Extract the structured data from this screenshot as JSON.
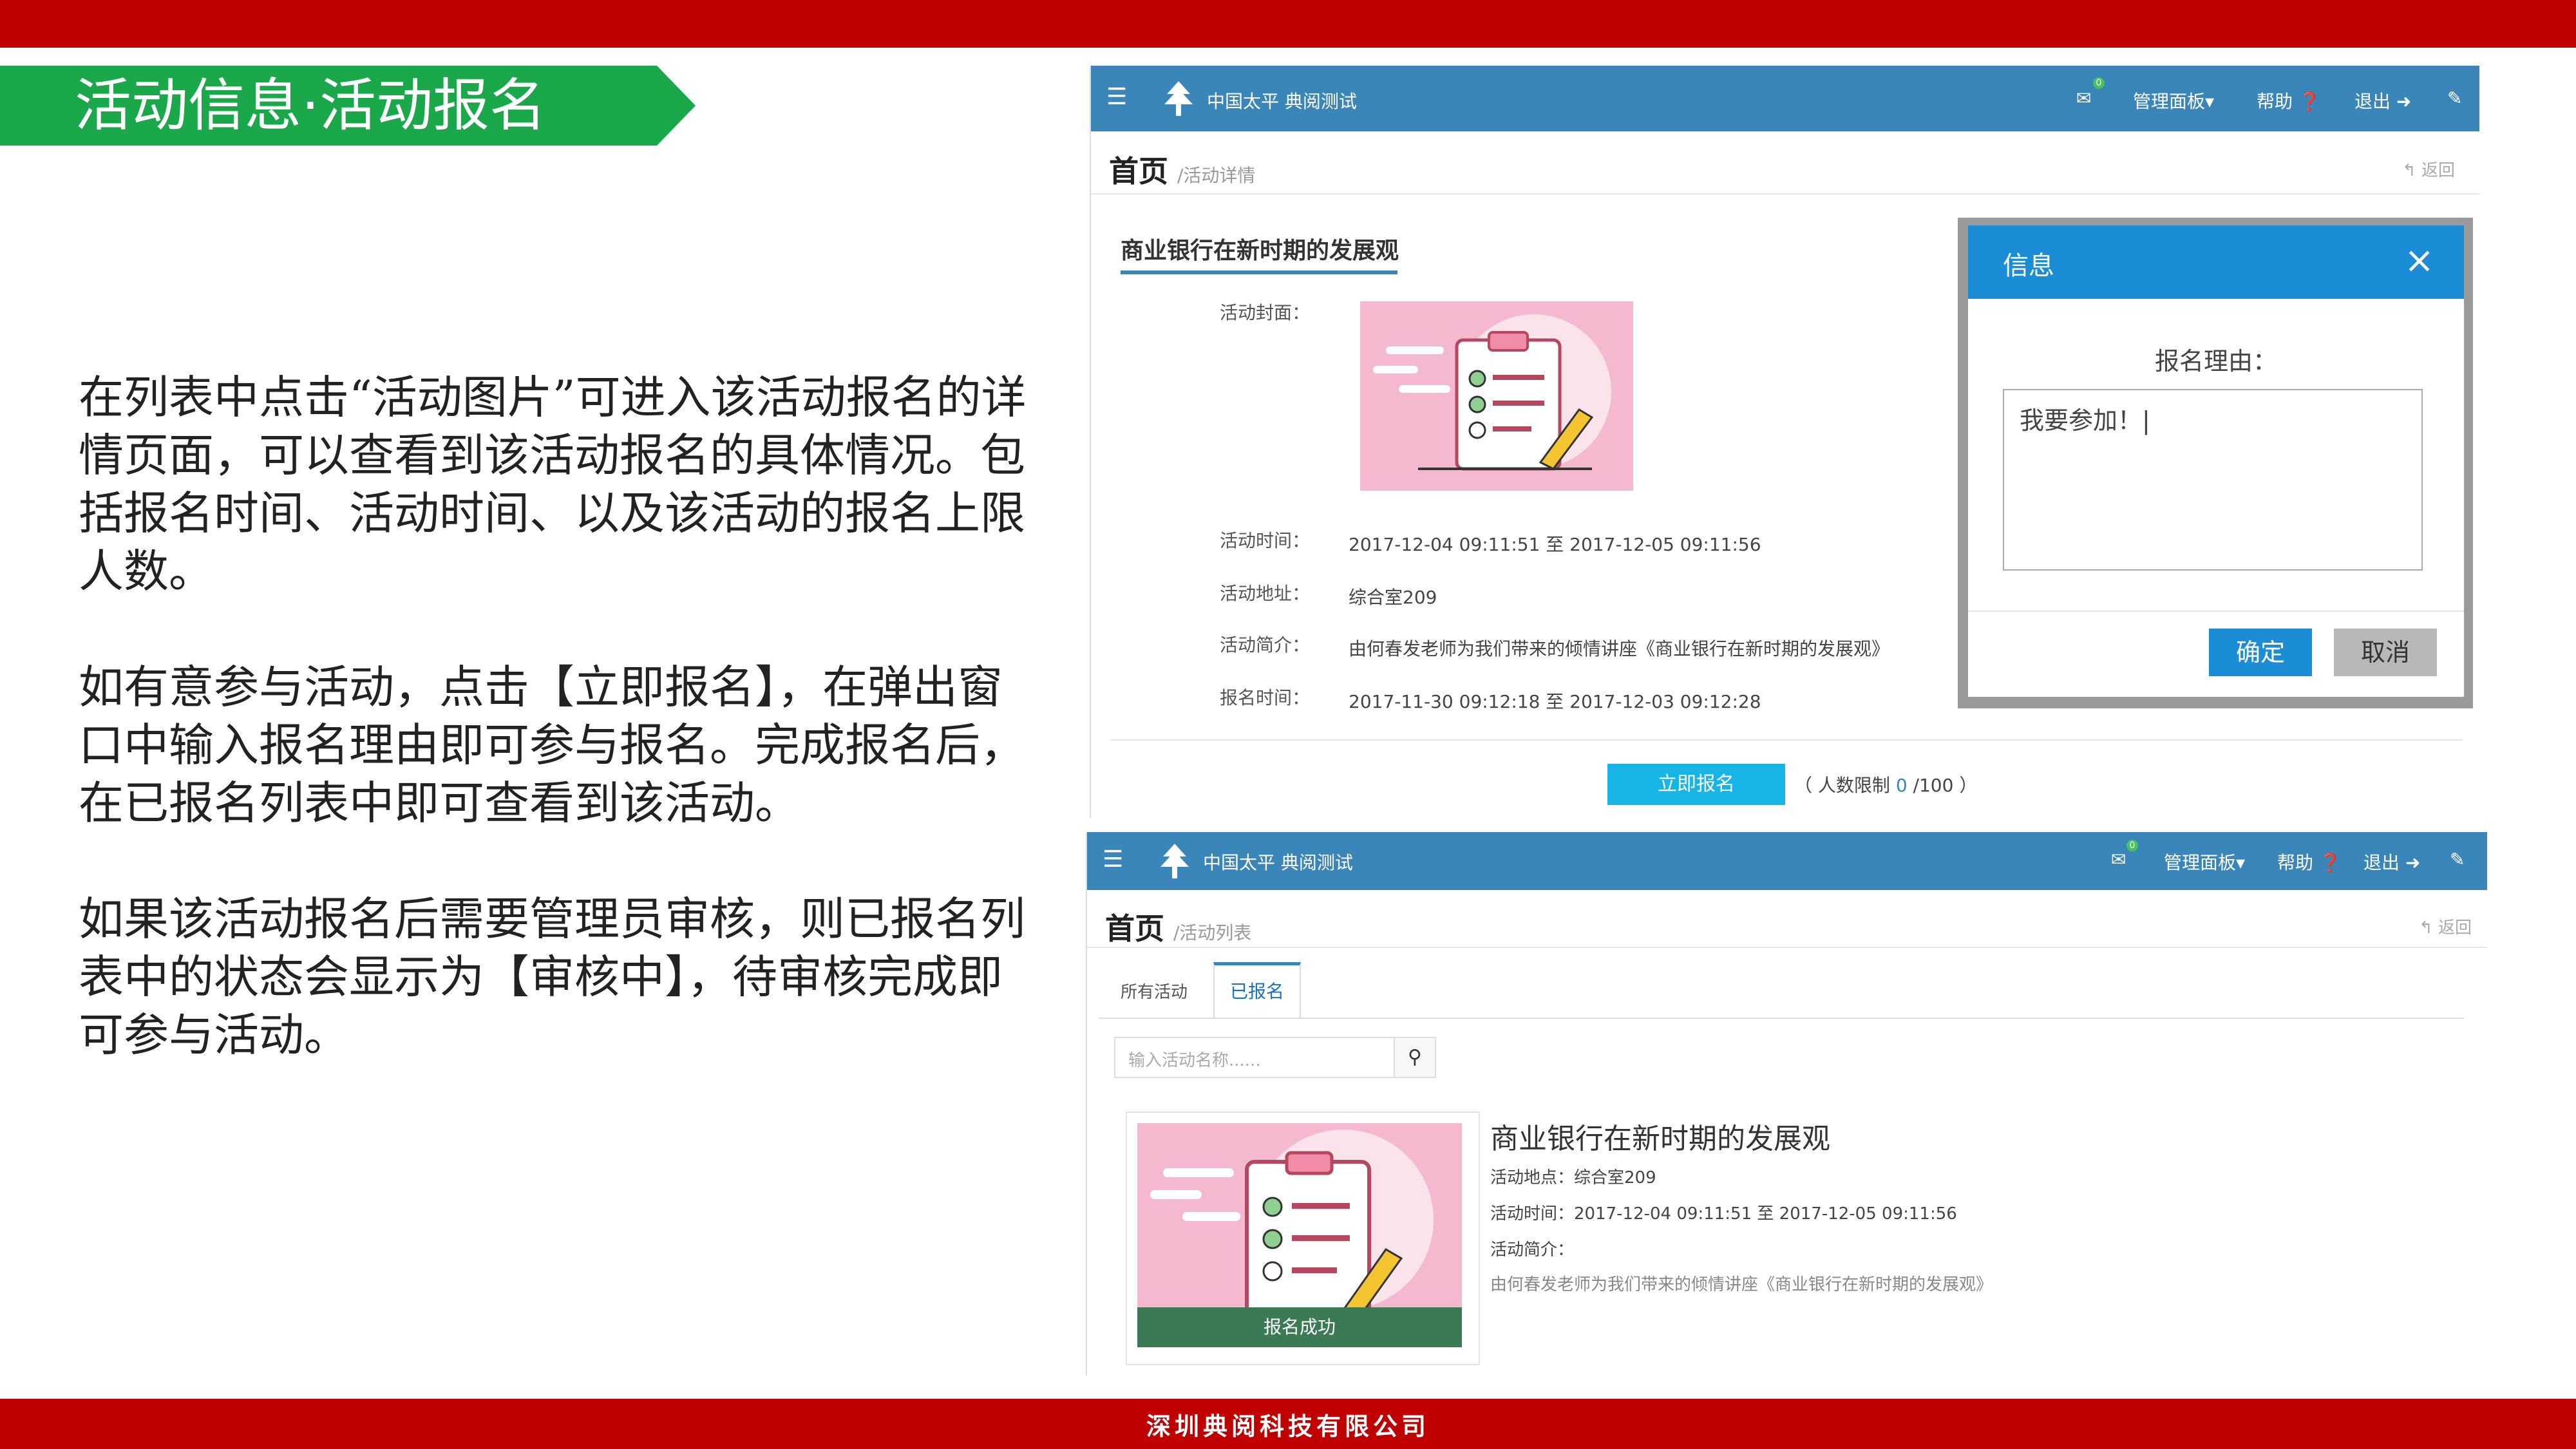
{
  "slide": {
    "title": "活动信息·活动报名",
    "paragraph1": "在列表中点击“活动图片”可进入该活动报名的详情页面，可以查看到该活动报名的具体情况。包括报名时间、活动时间、以及该活动的报名上限人数。",
    "paragraph2": "如有意参与活动，点击【立即报名】，在弹出窗口中输入报名理由即可参与报名。完成报名后，在已报名列表中即可查看到该活动。",
    "paragraph3": "如果该活动报名后需要管理员审核，则已报名列表中的状态会显示为【审核中】，待审核完成即可参与活动。",
    "footer": "深圳典阅科技有限公司"
  },
  "app": {
    "brand": "中国太平 典阅测试",
    "mail_badge": "0",
    "nav_manage": "管理面板▾",
    "nav_help": "帮助 ❓",
    "nav_logout": "退出 ➜",
    "home": "首页",
    "back": "↰ 返回"
  },
  "detail": {
    "subcrumb": "/活动详情",
    "title": "商业银行在新时期的发展观",
    "cover_label": "活动封面：",
    "time_label": "活动时间：",
    "time_value": "2017-12-04 09:11:51 至 2017-12-05 09:11:56",
    "address_label": "活动地址：",
    "address_value": "综合室209",
    "intro_label": "活动简介：",
    "intro_value": "由何春发老师为我们带来的倾情讲座《商业银行在新时期的发展观》",
    "signup_time_label": "报名时间：",
    "signup_time_value": "2017-11-30 09:12:18 至 2017-12-03 09:12:28",
    "signup_button": "立即报名",
    "limit_prefix": "（ 人数限制",
    "limit_current": "0",
    "limit_suffix": "/100 ）"
  },
  "modal": {
    "title": "信息",
    "close": "×",
    "label": "报名理由：",
    "text": "我要参加！",
    "ok": "确定",
    "cancel": "取消"
  },
  "list": {
    "subcrumb": "/活动列表",
    "tab_all": "所有活动",
    "tab_signed": "已报名",
    "search_placeholder": "输入活动名称......",
    "item_title": "商业银行在新时期的发展观",
    "item_address": "活动地点：综合室209",
    "item_time": "活动时间：2017-12-04 09:11:51 至 2017-12-05 09:11:56",
    "item_intro_label": "活动简介：",
    "item_intro": "由何春发老师为我们带来的倾情讲座《商业银行在新时期的发展观》",
    "status": "报名成功"
  },
  "colors": {
    "brand_red": "#c00000",
    "title_green": "#1aa84a",
    "navbar_blue": "#3a86b8",
    "button_cyan": "#17b4e6",
    "modal_blue": "#1a8dd6",
    "status_green": "#3c7a55"
  }
}
